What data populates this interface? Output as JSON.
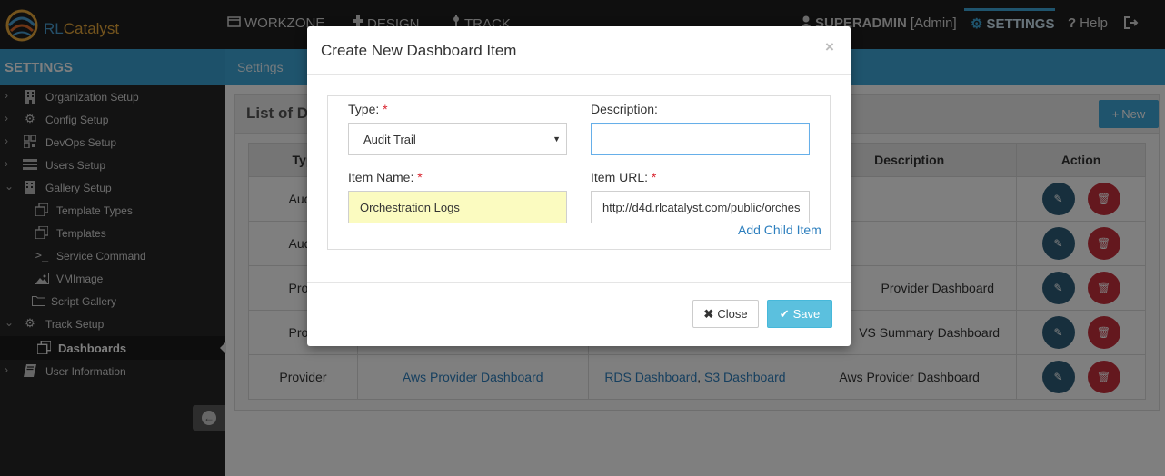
{
  "brand": {
    "prefix": "RL",
    "suffix": "Catalyst"
  },
  "topnav": {
    "items": [
      {
        "label": "WORKZONE",
        "icon": "workzone-icon"
      },
      {
        "label": "DESIGN",
        "icon": "design-icon"
      },
      {
        "label": "TRACK",
        "icon": "track-icon"
      }
    ],
    "user": {
      "name": "SUPERADMIN",
      "role": "[Admin]"
    },
    "settings_label": "SETTINGS",
    "help_label": "Help"
  },
  "settings_strip": {
    "title": "SETTINGS",
    "breadcrumb": "Settings"
  },
  "sidebar": {
    "items": [
      {
        "label": "Organization Setup",
        "icon": "building-icon",
        "chevron": "›"
      },
      {
        "label": "Config Setup",
        "icon": "gears-icon",
        "chevron": "›"
      },
      {
        "label": "DevOps Setup",
        "icon": "qrcode-icon",
        "chevron": "›"
      },
      {
        "label": "Users Setup",
        "icon": "users-list-icon",
        "chevron": "›"
      },
      {
        "label": "Gallery Setup",
        "icon": "gallery-icon",
        "chevron": "⌄"
      },
      {
        "label": "Template Types",
        "icon": "copy-icon"
      },
      {
        "label": "Templates",
        "icon": "copy-icon"
      },
      {
        "label": "Service Command",
        "icon": "terminal-icon"
      },
      {
        "label": "VMImage",
        "icon": "image-icon"
      },
      {
        "label": "Script Gallery",
        "icon": "folder-icon"
      },
      {
        "label": "Track Setup",
        "icon": "gears-icon",
        "chevron": "⌄"
      },
      {
        "label": "Dashboards",
        "icon": "copy-icon"
      },
      {
        "label": "User Information",
        "icon": "book-icon",
        "chevron": "›"
      }
    ]
  },
  "panel": {
    "title": "List of D",
    "new_label": "New",
    "columns": [
      "Typ",
      "Description",
      "Action"
    ],
    "rows": [
      {
        "type": "Audit",
        "name": "",
        "children": [],
        "description": ""
      },
      {
        "type": "Audit",
        "name": "",
        "children": [],
        "description": ""
      },
      {
        "type": "Provi",
        "name": "",
        "children": [],
        "description": "Provider Dashboard"
      },
      {
        "type": "Provi",
        "name": "",
        "children": [],
        "description": "VS Summary Dashboard"
      },
      {
        "type": "Provider",
        "name": "Aws Provider Dashboard",
        "children": [
          "RDS Dashboard",
          "S3 Dashboard"
        ],
        "description": "Aws Provider Dashboard"
      }
    ]
  },
  "modal": {
    "title": "Create New Dashboard Item",
    "close_x": "×",
    "type_label": "Type:",
    "type_value": "Audit Trail",
    "description_label": "Description:",
    "description_value": "",
    "item_name_label": "Item Name:",
    "item_name_value": "Orchestration Logs",
    "item_url_label": "Item URL:",
    "item_url_value": "http://d4d.rlcatalyst.com/public/orches",
    "required_mark": "*",
    "add_child_label": "Add Child Item",
    "close_label": "Close",
    "save_label": "Save"
  },
  "colors": {
    "accent": "#3fa9db",
    "topbar": "#1f1f1f",
    "sidebar": "#262626",
    "danger": "#c9303d",
    "edit": "#2f5f7a",
    "save": "#5bc0de"
  }
}
